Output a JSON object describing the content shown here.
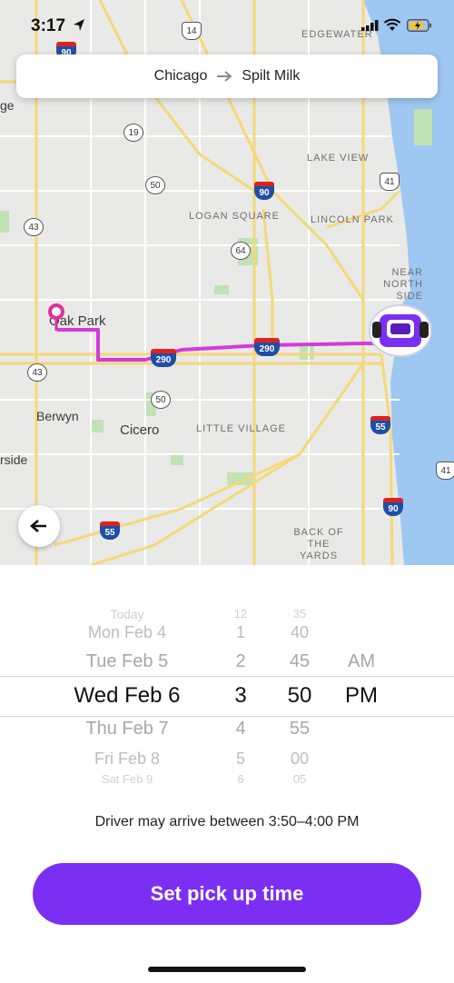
{
  "status_bar": {
    "time": "3:17",
    "icons": [
      "location-arrow-icon",
      "signal-icon",
      "wifi-icon",
      "battery-charging-icon"
    ]
  },
  "route": {
    "origin": "Chicago",
    "destination": "Spilt Milk",
    "arrow_icon": "arrow-right-icon"
  },
  "map": {
    "neighborhoods": [
      "EDGEWATER",
      "LAKE VIEW",
      "LOGAN SQUARE",
      "LINCOLN PARK",
      "NEAR NORTH SIDE",
      "LITTLE VILLAGE",
      "BACK OF THE YARDS"
    ],
    "cities": [
      "Oak Park",
      "Berwyn",
      "Cicero",
      "rside",
      "ge"
    ],
    "highway_shields": [
      "14",
      "90",
      "19",
      "50",
      "90",
      "41",
      "43",
      "64",
      "290",
      "290",
      "43",
      "50",
      "55",
      "41",
      "90",
      "55"
    ],
    "route_color": "#d43ad8",
    "origin_marker_color": "#e0309c",
    "car_color": "#7b2ff2"
  },
  "back_button_icon": "arrow-left-icon",
  "picker": {
    "date_options": [
      "Today",
      "Mon Feb 4",
      "Tue Feb 5",
      "Wed Feb 6",
      "Thu Feb 7",
      "Fri Feb 8",
      "Sat Feb 9"
    ],
    "hour_options": [
      "12",
      "1",
      "2",
      "3",
      "4",
      "5",
      "6"
    ],
    "minute_options": [
      "35",
      "40",
      "45",
      "50",
      "55",
      "00",
      "05"
    ],
    "ampm_options": [
      "AM",
      "PM"
    ],
    "selected": {
      "date": "Wed Feb 6",
      "hour": "3",
      "minute": "50",
      "ampm": "PM"
    }
  },
  "driver_note": "Driver may arrive between 3:50–4:00 PM",
  "cta": {
    "label": "Set pick up time",
    "color": "#7b2ff2"
  }
}
